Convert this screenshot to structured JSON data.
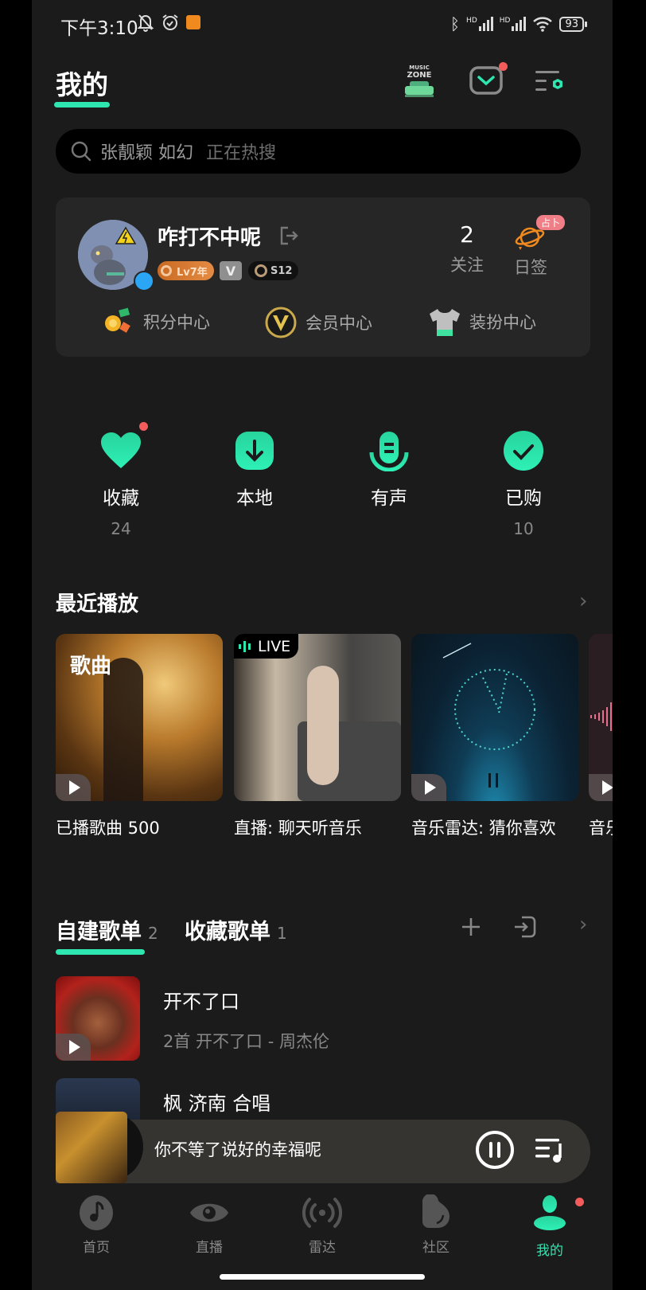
{
  "status_bar": {
    "time": "下午3:10",
    "network_1": "HD",
    "network_2": "HD",
    "battery": "93"
  },
  "header": {
    "title": "我的",
    "music_zone_label_top": "MUSIC",
    "music_zone_label_bottom": "ZONE",
    "has_mail_notification": true
  },
  "search": {
    "placeholder": "张靓颖 如幻",
    "hot_label": "正在热搜"
  },
  "profile": {
    "username": "咋打不中呢",
    "level_badge": "Lv7年",
    "vip_badge": "V",
    "season_badge": "S12",
    "follow_count": "2",
    "follow_label": "关注",
    "checkin_label": "日签",
    "checkin_badge": "占卜",
    "centers": [
      {
        "label": "积分中心",
        "icon": "coins-icon"
      },
      {
        "label": "会员中心",
        "icon": "vip-icon"
      },
      {
        "label": "装扮中心",
        "icon": "tshirt-icon"
      }
    ]
  },
  "quick_access": [
    {
      "label": "收藏",
      "count": "24",
      "icon": "heart-icon",
      "dot": true
    },
    {
      "label": "本地",
      "count": "",
      "icon": "download-icon",
      "dot": false
    },
    {
      "label": "有声",
      "count": "",
      "icon": "microphone-icon",
      "dot": false
    },
    {
      "label": "已购",
      "count": "10",
      "icon": "check-icon",
      "dot": false
    }
  ],
  "recent": {
    "title": "最近播放",
    "cards": [
      {
        "label": "已播歌曲 500",
        "tag": "歌曲"
      },
      {
        "label": "直播: 聊天听音乐",
        "tag": "LIVE"
      },
      {
        "label": "音乐雷达: 猜你喜欢",
        "tag": ""
      },
      {
        "label": "音乐",
        "tag": ""
      }
    ]
  },
  "playlists": {
    "tabs": [
      {
        "label": "自建歌单",
        "count": "2"
      },
      {
        "label": "收藏歌单",
        "count": "1"
      }
    ],
    "items": [
      {
        "title": "开不了口",
        "subtitle": "2首 开不了口 - 周杰伦"
      },
      {
        "title": "枫 济南 合唱",
        "subtitle": ""
      }
    ]
  },
  "player": {
    "now_playing": "你不等了说好的幸福呢"
  },
  "tab_bar": [
    {
      "label": "首页",
      "icon": "home-note-icon",
      "active": false
    },
    {
      "label": "直播",
      "icon": "eye-icon",
      "active": false
    },
    {
      "label": "雷达",
      "icon": "radar-icon",
      "active": false
    },
    {
      "label": "社区",
      "icon": "community-icon",
      "active": false
    },
    {
      "label": "我的",
      "icon": "profile-icon",
      "active": true
    }
  ],
  "colors": {
    "accent": "#2ee6b0",
    "background": "#1b1b1b",
    "card": "#262626",
    "notification": "#f45b5b"
  }
}
